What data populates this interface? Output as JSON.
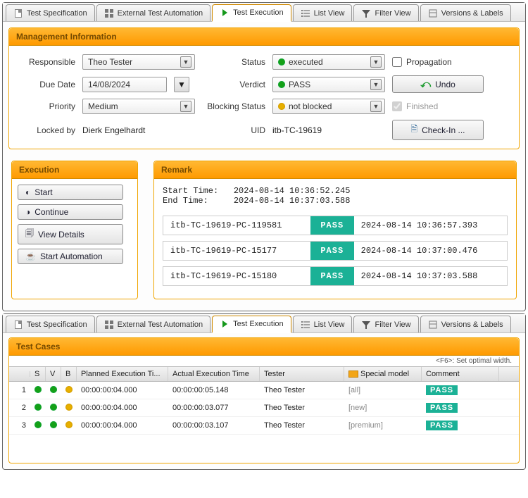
{
  "tabs": {
    "spec": "Test Specification",
    "ext": "External Test Automation",
    "exec": "Test Execution",
    "list": "List View",
    "filter": "Filter View",
    "versions": "Versions & Labels"
  },
  "management": {
    "title": "Management Information",
    "labels": {
      "responsible": "Responsible",
      "dueDate": "Due Date",
      "priority": "Priority",
      "lockedBy": "Locked by",
      "status": "Status",
      "verdict": "Verdict",
      "blocking": "Blocking Status",
      "uid": "UID",
      "propagation": "Propagation",
      "finished": "Finished"
    },
    "values": {
      "responsible": "Theo Tester",
      "dueDate": "14/08/2024",
      "priority": "Medium",
      "lockedBy": "Dierk Engelhardt",
      "status": "executed",
      "verdict": "PASS",
      "blocking": "not blocked",
      "uid": "itb-TC-19619"
    },
    "buttons": {
      "undo": "Undo",
      "checkin": "Check-In ..."
    }
  },
  "execution": {
    "title": "Execution",
    "buttons": {
      "start": "Start",
      "continue": "Continue",
      "viewDetails": "View Details",
      "startAutomation": "Start Automation"
    }
  },
  "remark": {
    "title": "Remark",
    "startLabel": "Start Time:",
    "endLabel": "End Time:",
    "startTime": "2024-08-14 10:36:52.245",
    "endTime": "2024-08-14 10:37:03.588",
    "entries": [
      {
        "id": "itb-TC-19619-PC-119581",
        "badge": "PASS",
        "ts": "2024-08-14 10:36:57.393"
      },
      {
        "id": "itb-TC-19619-PC-15177",
        "badge": "PASS",
        "ts": "2024-08-14 10:37:00.476"
      },
      {
        "id": "itb-TC-19619-PC-15180",
        "badge": "PASS",
        "ts": "2024-08-14 10:37:03.588"
      }
    ]
  },
  "testcases": {
    "title": "Test Cases",
    "hint": "<F6>: Set optimal width.",
    "columns": {
      "s": "S",
      "v": "V",
      "b": "B",
      "planned": "Planned Execution Ti...",
      "actual": "Actual Execution Time",
      "tester": "Tester",
      "special": "Special model",
      "comment": "Comment"
    },
    "rows": [
      {
        "n": "1",
        "planned": "00:00:00:04.000",
        "actual": "00:00:00:05.148",
        "tester": "Theo Tester",
        "special": "[all]",
        "comment": "PASS"
      },
      {
        "n": "2",
        "planned": "00:00:00:04.000",
        "actual": "00:00:00:03.077",
        "tester": "Theo Tester",
        "special": "[new]",
        "comment": "PASS"
      },
      {
        "n": "3",
        "planned": "00:00:00:04.000",
        "actual": "00:00:00:03.107",
        "tester": "Theo Tester",
        "special": "[premium]",
        "comment": "PASS"
      }
    ]
  }
}
